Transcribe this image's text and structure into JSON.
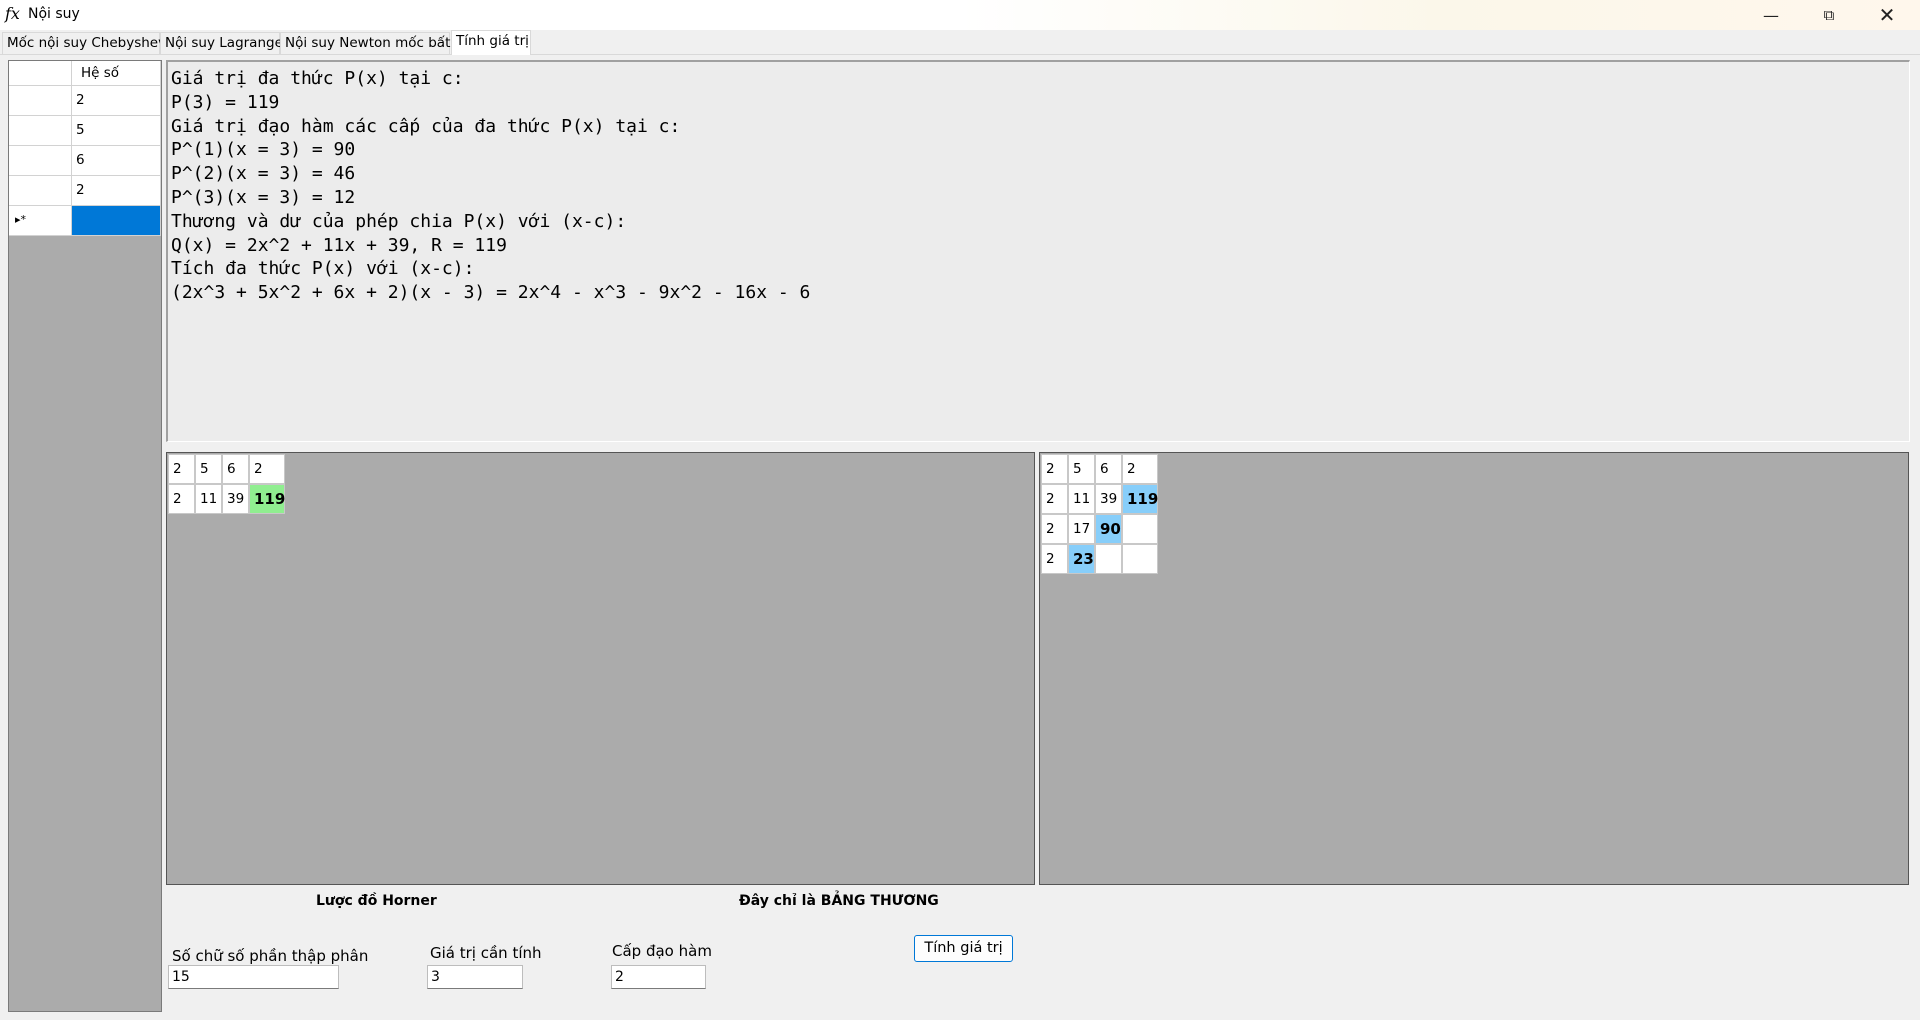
{
  "window": {
    "title": "Nội suy",
    "icon": "fx-icon"
  },
  "tabs": [
    {
      "label": "Mốc nội suy Chebyshev"
    },
    {
      "label": "Nội suy Lagrange"
    },
    {
      "label": "Nội suy Newton mốc bất kì"
    },
    {
      "label": "Tính giá trị",
      "active": true
    }
  ],
  "coef_grid": {
    "header": "Hệ số",
    "rows": [
      "2",
      "5",
      "6",
      "2"
    ],
    "new_row_marker": "▸*"
  },
  "output_lines": [
    "Giá trị đa thức P(x) tại c:",
    "P(3) = 119",
    "Giá trị đạo hàm các cấp của đa thức P(x) tại c:",
    "P^(1)(x = 3) = 90",
    "P^(2)(x = 3) = 46",
    "P^(3)(x = 3) = 12",
    "Thương và dư của phép chia P(x) với (x-c):",
    "Q(x) = 2x^2 + 11x + 39, R = 119",
    "Tích đa thức P(x) với (x-c):",
    "(2x^3 + 5x^2 + 6x + 2)(x - 3) = 2x^4 - x^3 - 9x^2 - 16x - 6"
  ],
  "horner_table": {
    "rows": [
      [
        "2",
        "5",
        "6",
        "2"
      ],
      [
        "2",
        "11",
        "39",
        "119"
      ]
    ],
    "highlight_color": "#90ee90"
  },
  "quotient_table": {
    "rows": [
      [
        "2",
        "5",
        "6",
        "2"
      ],
      [
        "2",
        "11",
        "39",
        "119"
      ],
      [
        "2",
        "17",
        "90",
        ""
      ],
      [
        "2",
        "23",
        "",
        ""
      ]
    ],
    "highlight_color": "#87cefa"
  },
  "captions": {
    "horner": "Lược đồ Horner",
    "quotient": "Đây chỉ là BẢNG THƯƠNG"
  },
  "fields": {
    "decimals_label": "Số chữ số phần thập phân",
    "decimals_value": "15",
    "value_label": "Giá trị cần tính",
    "value_value": "3",
    "order_label": "Cấp đạo hàm",
    "order_value": "2"
  },
  "button": {
    "label": "Tính giá trị"
  }
}
